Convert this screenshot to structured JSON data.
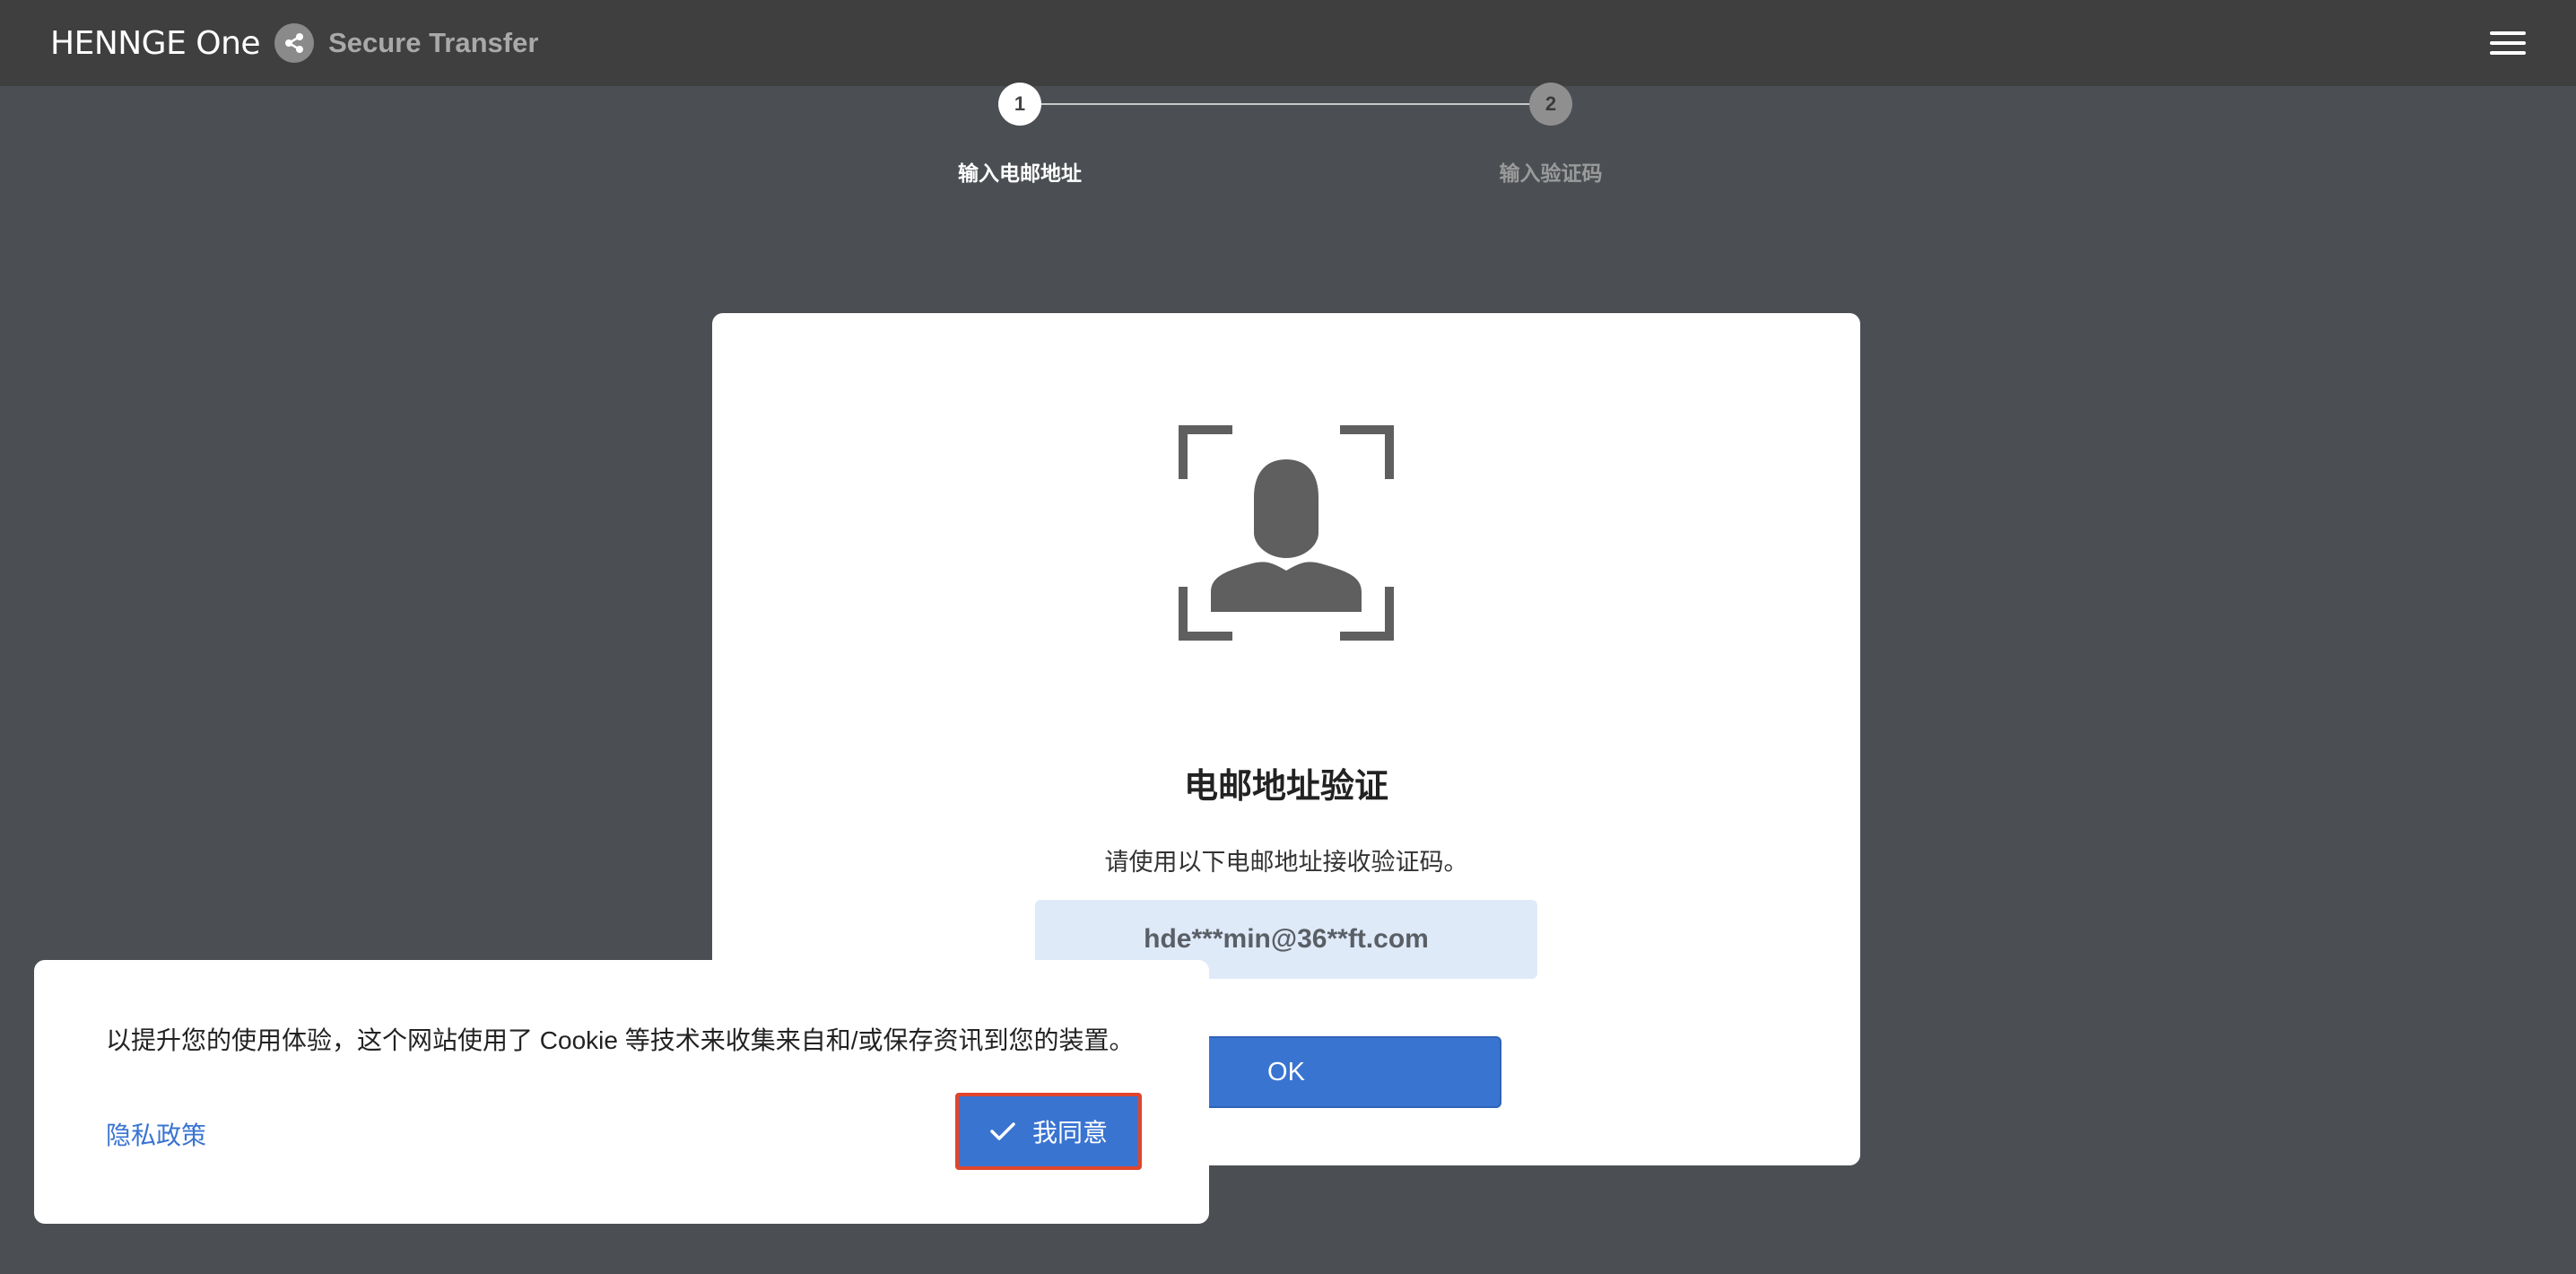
{
  "header": {
    "brand_name": "HENNGE One",
    "product_name": "Secure Transfer",
    "menu_icon": "hamburger-menu-icon"
  },
  "stepper": {
    "steps": [
      {
        "number": "1",
        "label": "输入电邮地址",
        "active": true
      },
      {
        "number": "2",
        "label": "输入验证码",
        "active": false
      }
    ]
  },
  "card": {
    "icon": "user-scan-icon",
    "title": "电邮地址验证",
    "description": "请使用以下电邮地址接收验证码。",
    "email": "hde***min@36**ft.com",
    "ok_label": "OK"
  },
  "cookie_banner": {
    "text": "以提升您的使用体验，这个网站使用了 Cookie 等技术来收集来自和/或保存资讯到您的装置。",
    "privacy_label": "隐私政策",
    "agree_label": "我同意",
    "agree_icon": "checkmark-icon"
  },
  "colors": {
    "accent": "#3a74d1",
    "header_bg": "#3f3f3f",
    "page_bg": "#4b4f53",
    "highlight_border": "#e0452c"
  }
}
